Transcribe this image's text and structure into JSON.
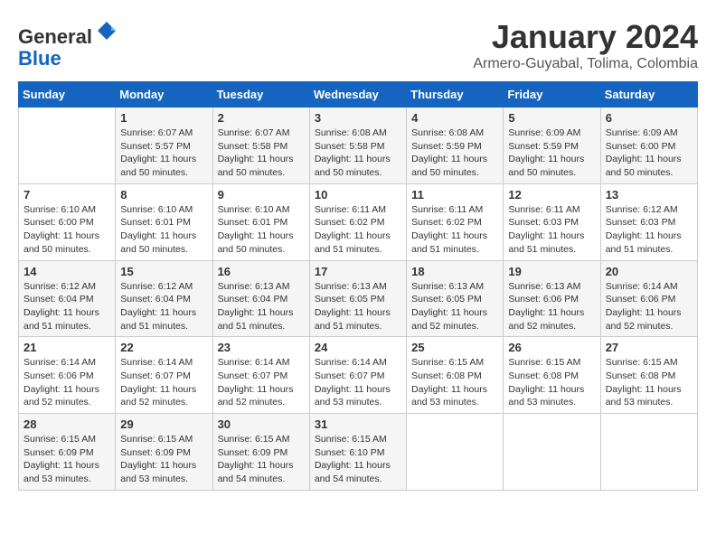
{
  "header": {
    "logo_line1": "General",
    "logo_line2": "Blue",
    "month": "January 2024",
    "location": "Armero-Guyabal, Tolima, Colombia"
  },
  "days_of_week": [
    "Sunday",
    "Monday",
    "Tuesday",
    "Wednesday",
    "Thursday",
    "Friday",
    "Saturday"
  ],
  "weeks": [
    [
      {
        "day": "",
        "sunrise": "",
        "sunset": "",
        "daylight": ""
      },
      {
        "day": "1",
        "sunrise": "6:07 AM",
        "sunset": "5:57 PM",
        "daylight": "11 hours and 50 minutes."
      },
      {
        "day": "2",
        "sunrise": "6:07 AM",
        "sunset": "5:58 PM",
        "daylight": "11 hours and 50 minutes."
      },
      {
        "day": "3",
        "sunrise": "6:08 AM",
        "sunset": "5:58 PM",
        "daylight": "11 hours and 50 minutes."
      },
      {
        "day": "4",
        "sunrise": "6:08 AM",
        "sunset": "5:59 PM",
        "daylight": "11 hours and 50 minutes."
      },
      {
        "day": "5",
        "sunrise": "6:09 AM",
        "sunset": "5:59 PM",
        "daylight": "11 hours and 50 minutes."
      },
      {
        "day": "6",
        "sunrise": "6:09 AM",
        "sunset": "6:00 PM",
        "daylight": "11 hours and 50 minutes."
      }
    ],
    [
      {
        "day": "7",
        "sunrise": "6:10 AM",
        "sunset": "6:00 PM",
        "daylight": "11 hours and 50 minutes."
      },
      {
        "day": "8",
        "sunrise": "6:10 AM",
        "sunset": "6:01 PM",
        "daylight": "11 hours and 50 minutes."
      },
      {
        "day": "9",
        "sunrise": "6:10 AM",
        "sunset": "6:01 PM",
        "daylight": "11 hours and 50 minutes."
      },
      {
        "day": "10",
        "sunrise": "6:11 AM",
        "sunset": "6:02 PM",
        "daylight": "11 hours and 51 minutes."
      },
      {
        "day": "11",
        "sunrise": "6:11 AM",
        "sunset": "6:02 PM",
        "daylight": "11 hours and 51 minutes."
      },
      {
        "day": "12",
        "sunrise": "6:11 AM",
        "sunset": "6:03 PM",
        "daylight": "11 hours and 51 minutes."
      },
      {
        "day": "13",
        "sunrise": "6:12 AM",
        "sunset": "6:03 PM",
        "daylight": "11 hours and 51 minutes."
      }
    ],
    [
      {
        "day": "14",
        "sunrise": "6:12 AM",
        "sunset": "6:04 PM",
        "daylight": "11 hours and 51 minutes."
      },
      {
        "day": "15",
        "sunrise": "6:12 AM",
        "sunset": "6:04 PM",
        "daylight": "11 hours and 51 minutes."
      },
      {
        "day": "16",
        "sunrise": "6:13 AM",
        "sunset": "6:04 PM",
        "daylight": "11 hours and 51 minutes."
      },
      {
        "day": "17",
        "sunrise": "6:13 AM",
        "sunset": "6:05 PM",
        "daylight": "11 hours and 51 minutes."
      },
      {
        "day": "18",
        "sunrise": "6:13 AM",
        "sunset": "6:05 PM",
        "daylight": "11 hours and 52 minutes."
      },
      {
        "day": "19",
        "sunrise": "6:13 AM",
        "sunset": "6:06 PM",
        "daylight": "11 hours and 52 minutes."
      },
      {
        "day": "20",
        "sunrise": "6:14 AM",
        "sunset": "6:06 PM",
        "daylight": "11 hours and 52 minutes."
      }
    ],
    [
      {
        "day": "21",
        "sunrise": "6:14 AM",
        "sunset": "6:06 PM",
        "daylight": "11 hours and 52 minutes."
      },
      {
        "day": "22",
        "sunrise": "6:14 AM",
        "sunset": "6:07 PM",
        "daylight": "11 hours and 52 minutes."
      },
      {
        "day": "23",
        "sunrise": "6:14 AM",
        "sunset": "6:07 PM",
        "daylight": "11 hours and 52 minutes."
      },
      {
        "day": "24",
        "sunrise": "6:14 AM",
        "sunset": "6:07 PM",
        "daylight": "11 hours and 53 minutes."
      },
      {
        "day": "25",
        "sunrise": "6:15 AM",
        "sunset": "6:08 PM",
        "daylight": "11 hours and 53 minutes."
      },
      {
        "day": "26",
        "sunrise": "6:15 AM",
        "sunset": "6:08 PM",
        "daylight": "11 hours and 53 minutes."
      },
      {
        "day": "27",
        "sunrise": "6:15 AM",
        "sunset": "6:08 PM",
        "daylight": "11 hours and 53 minutes."
      }
    ],
    [
      {
        "day": "28",
        "sunrise": "6:15 AM",
        "sunset": "6:09 PM",
        "daylight": "11 hours and 53 minutes."
      },
      {
        "day": "29",
        "sunrise": "6:15 AM",
        "sunset": "6:09 PM",
        "daylight": "11 hours and 53 minutes."
      },
      {
        "day": "30",
        "sunrise": "6:15 AM",
        "sunset": "6:09 PM",
        "daylight": "11 hours and 54 minutes."
      },
      {
        "day": "31",
        "sunrise": "6:15 AM",
        "sunset": "6:10 PM",
        "daylight": "11 hours and 54 minutes."
      },
      {
        "day": "",
        "sunrise": "",
        "sunset": "",
        "daylight": ""
      },
      {
        "day": "",
        "sunrise": "",
        "sunset": "",
        "daylight": ""
      },
      {
        "day": "",
        "sunrise": "",
        "sunset": "",
        "daylight": ""
      }
    ]
  ]
}
